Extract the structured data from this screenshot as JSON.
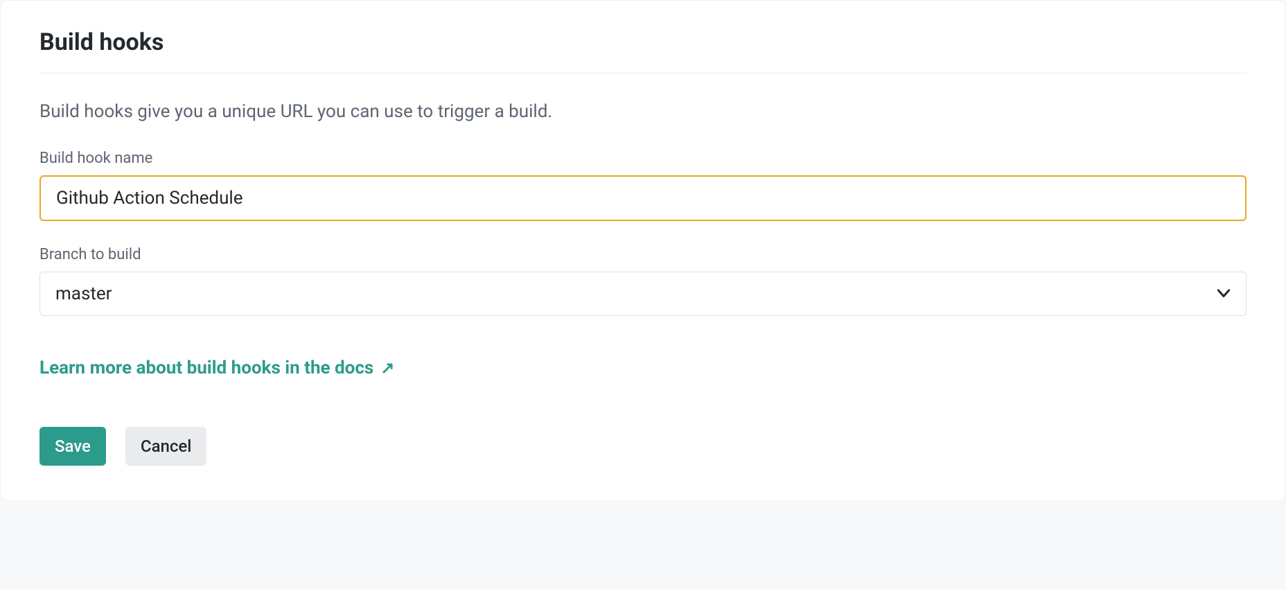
{
  "section": {
    "title": "Build hooks",
    "description": "Build hooks give you a unique URL you can use to trigger a build."
  },
  "form": {
    "hook_name_label": "Build hook name",
    "hook_name_value": "Github Action Schedule",
    "branch_label": "Branch to build",
    "branch_value": "master"
  },
  "link": {
    "text": "Learn more about build hooks in the docs"
  },
  "buttons": {
    "save": "Save",
    "cancel": "Cancel"
  }
}
